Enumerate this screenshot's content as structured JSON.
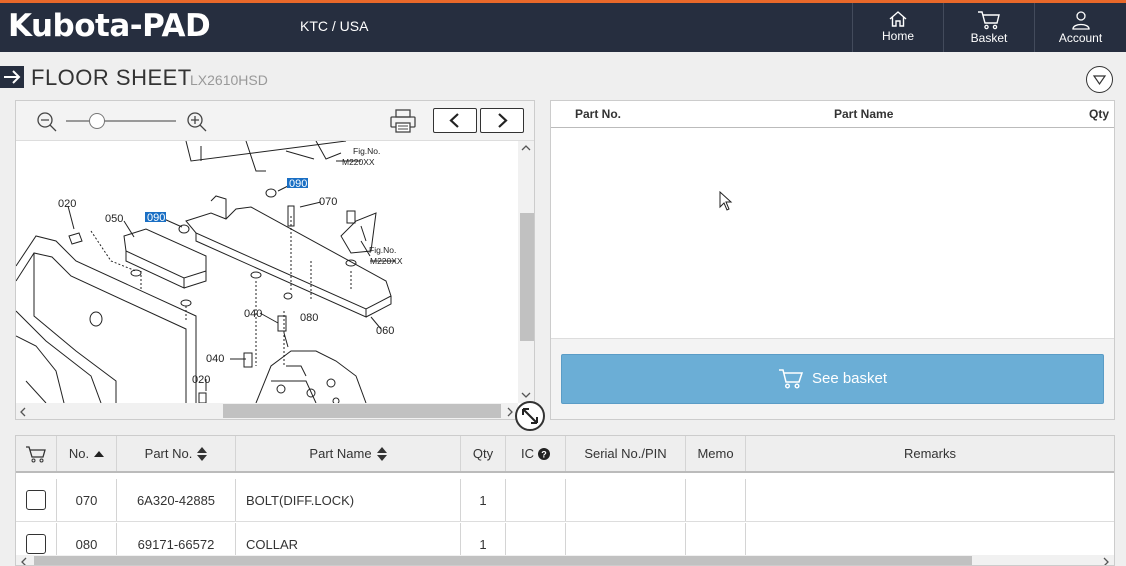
{
  "header": {
    "logo": "Kubota-PAD",
    "region": "KTC / USA",
    "nav": [
      {
        "label": "Home",
        "icon": "home-icon"
      },
      {
        "label": "Basket",
        "icon": "cart-icon"
      },
      {
        "label": "Account",
        "icon": "user-icon"
      }
    ]
  },
  "page": {
    "title": "FLOOR SHEET",
    "model": "LX2610HSD"
  },
  "diagram": {
    "labels": [
      "020",
      "050",
      "090",
      "090",
      "070",
      "060",
      "080",
      "040",
      "040",
      "020"
    ],
    "fig_ref": [
      "Fig.No.",
      "M220XX"
    ],
    "highlight_color": "#1a6fc4"
  },
  "basket": {
    "columns": [
      "Part No.",
      "Part Name",
      "Qty"
    ],
    "button_label": "See basket",
    "button_color": "#6baed6"
  },
  "table": {
    "columns": [
      "No.",
      "Part No.",
      "Part Name",
      "Qty",
      "IC",
      "Serial No./PIN",
      "Memo",
      "Remarks"
    ],
    "rows": [
      {
        "no": "070",
        "part_no": "6A320-42885",
        "part_name": "BOLT(DIFF.LOCK)",
        "qty": "1",
        "ic": "",
        "serial": "",
        "memo": "",
        "remarks": ""
      },
      {
        "no": "080",
        "part_no": "69171-66572",
        "part_name": "COLLAR",
        "qty": "1",
        "ic": "",
        "serial": "",
        "memo": "",
        "remarks": ""
      }
    ]
  }
}
